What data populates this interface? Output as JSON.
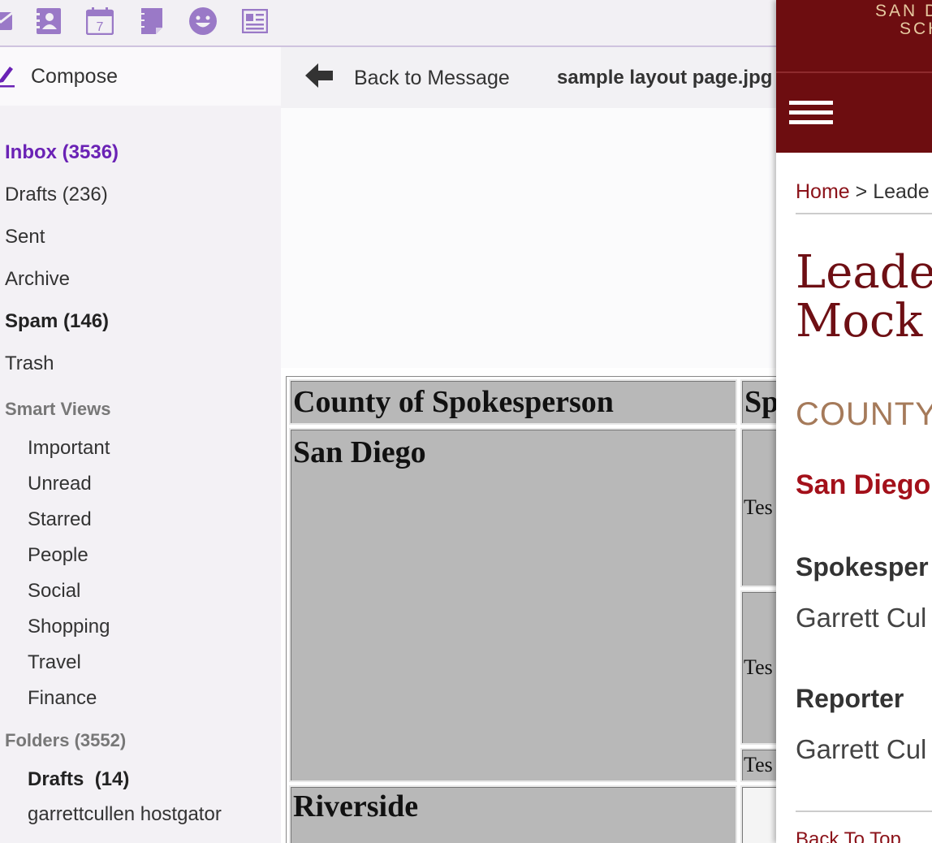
{
  "toolbar": {
    "icons": [
      "mail-icon",
      "contacts-icon",
      "calendar-icon",
      "notepad-icon",
      "messenger-smiley-icon",
      "newsfeed-icon"
    ],
    "calendar_day": "7",
    "accent_color": "#9a79c7"
  },
  "sidebar": {
    "compose_label": "Compose",
    "folders_main": [
      {
        "label": "Inbox (3536)",
        "style": "active"
      },
      {
        "label": "Drafts (236)",
        "style": "normal"
      },
      {
        "label": "Sent",
        "style": "normal"
      },
      {
        "label": "Archive",
        "style": "normal"
      },
      {
        "label": "Spam (146)",
        "style": "bold"
      },
      {
        "label": "Trash",
        "style": "normal"
      }
    ],
    "smart_views_label": "Smart Views",
    "smart_views": [
      "Important",
      "Unread",
      "Starred",
      "People",
      "Social",
      "Shopping",
      "Travel",
      "Finance"
    ],
    "folders_label": "Folders (3552)",
    "folders": [
      {
        "label": "Drafts  (14)",
        "style": "bold"
      },
      {
        "label": "garrettcullen hostgator",
        "style": "normal"
      }
    ]
  },
  "message": {
    "back_label": "Back to Message",
    "attachment_name": "sample layout page.jpg"
  },
  "document": {
    "header_county": "County of Spokesperson",
    "header_second": "Sp",
    "row1_county": "San Diego",
    "row1_cells": [
      "Tes",
      "Tes",
      "Tes"
    ],
    "row2_county": "Riverside"
  },
  "overlay": {
    "brand_line1": "SAN D",
    "brand_line2": "SCH",
    "breadcrumb_home": "Home",
    "breadcrumb_sep": " > ",
    "breadcrumb_current": "Leade",
    "title_line1": "Leader",
    "title_line2": "Mock L",
    "county_label": "COUNTY",
    "county_name": "San Diego",
    "spokesperson_label": "Spokesper",
    "spokesperson_value": "Garrett Cul",
    "reporter_label": "Reporter",
    "reporter_value": "Garrett Cul",
    "back_to_top": "Back To Top",
    "header_color": "#6d0d10"
  }
}
